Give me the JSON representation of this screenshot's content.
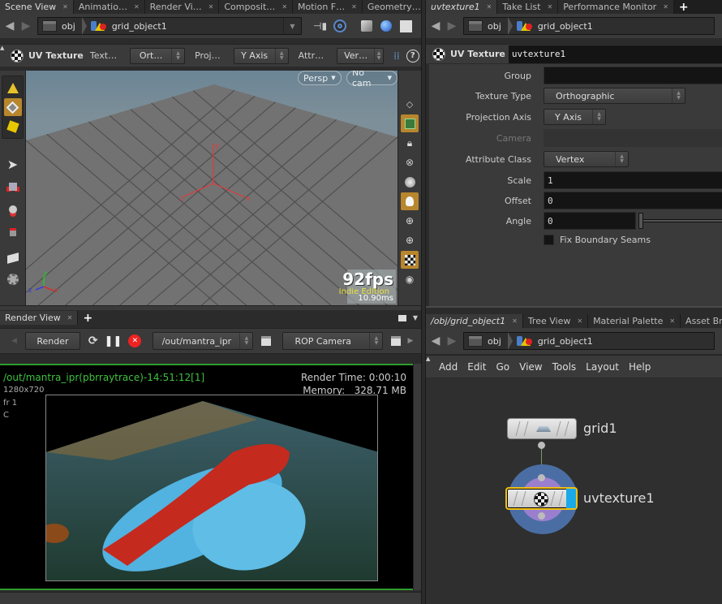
{
  "scene_pane": {
    "tabs": [
      {
        "label": "Scene View",
        "active": true
      },
      {
        "label": "Animatio…"
      },
      {
        "label": "Render Vi…"
      },
      {
        "label": "Composit…"
      },
      {
        "label": "Motion F…"
      },
      {
        "label": "Geometry…"
      }
    ],
    "path": {
      "root": "obj",
      "object": "grid_object1"
    },
    "op_toolbar": {
      "node_type": "UV Texture",
      "texture_label": "Text…",
      "texture_value": "Ort…",
      "proj_label": "Proj…",
      "proj_value": "Y Axis",
      "attr_label": "Attr…",
      "attr_value": "Ver…"
    },
    "viewport": {
      "view_menu": "Persp",
      "cam_menu": "No cam",
      "fps": "92fps",
      "edition": "Indie Edition",
      "frame_time": "10.90ms",
      "axis_labels": {
        "x": "x",
        "y": "y",
        "z": "z"
      }
    },
    "left_shelf": [
      "create-geo-icon",
      "select-mode-icon",
      "primitive-select-icon",
      "select-arrow-icon",
      "move-icon",
      "rotate-icon",
      "scale-icon",
      "handle-icon",
      "render-camera-icon"
    ],
    "right_shelf": [
      "display-options-icon",
      "wireframe-icon",
      "lock-icon",
      "hide-icon",
      "light-sphere-icon",
      "headlight-icon",
      "light-add-icon",
      "light-link-icon",
      "shaded-cube-icon",
      "visibility-eye-icon"
    ]
  },
  "render_pane": {
    "tab": "Render View",
    "render_button": "Render",
    "rop_path": "/out/mantra_ipr",
    "camera": "ROP Camera",
    "status_line": "/out/mantra_ipr(pbrraytrace)-14:51:12[1]",
    "resolution": "1280x720",
    "frame": "fr 1",
    "channel": "C",
    "render_time": "Render Time: 0:00:10",
    "memory": "Memory:   328.71 MB",
    "accent_color": "#3ec23e"
  },
  "parm_pane": {
    "tabs": [
      {
        "label": "uvtexture1",
        "active": true
      },
      {
        "label": "Take List"
      },
      {
        "label": "Performance Monitor"
      }
    ],
    "path": {
      "root": "obj",
      "object": "grid_object1"
    },
    "node_type": "UV Texture",
    "node_name": "uvtexture1",
    "parms": {
      "group_label": "Group",
      "group_value": "",
      "texture_type_label": "Texture Type",
      "texture_type_value": "Orthographic",
      "projection_axis_label": "Projection Axis",
      "projection_axis_value": "Y Axis",
      "camera_label": "Camera",
      "camera_value": "",
      "attribute_class_label": "Attribute Class",
      "attribute_class_value": "Vertex",
      "scale_label": "Scale",
      "scale_value": "1",
      "offset_label": "Offset",
      "offset_value": "0",
      "angle_label": "Angle",
      "angle_value": "0",
      "fix_seams_label": "Fix Boundary Seams",
      "fix_seams_checked": false
    }
  },
  "network_pane": {
    "tabs": [
      {
        "label": "/obj/grid_object1",
        "active": true
      },
      {
        "label": "Tree View"
      },
      {
        "label": "Material Palette"
      },
      {
        "label": "Asset Browser"
      }
    ],
    "path": {
      "root": "obj",
      "object": "grid_object1"
    },
    "menu": [
      "Add",
      "Edit",
      "Go",
      "View",
      "Tools",
      "Layout",
      "Help"
    ],
    "nodes": [
      {
        "name": "grid1",
        "selected": false
      },
      {
        "name": "uvtexture1",
        "selected": true,
        "display_flag": true
      }
    ],
    "colors": {
      "selected_outline": "#f0c010",
      "display_flag": "#1aa9e8",
      "ring_outer": "#4a6ea3",
      "ring_inner": "#9b7fcf"
    }
  }
}
